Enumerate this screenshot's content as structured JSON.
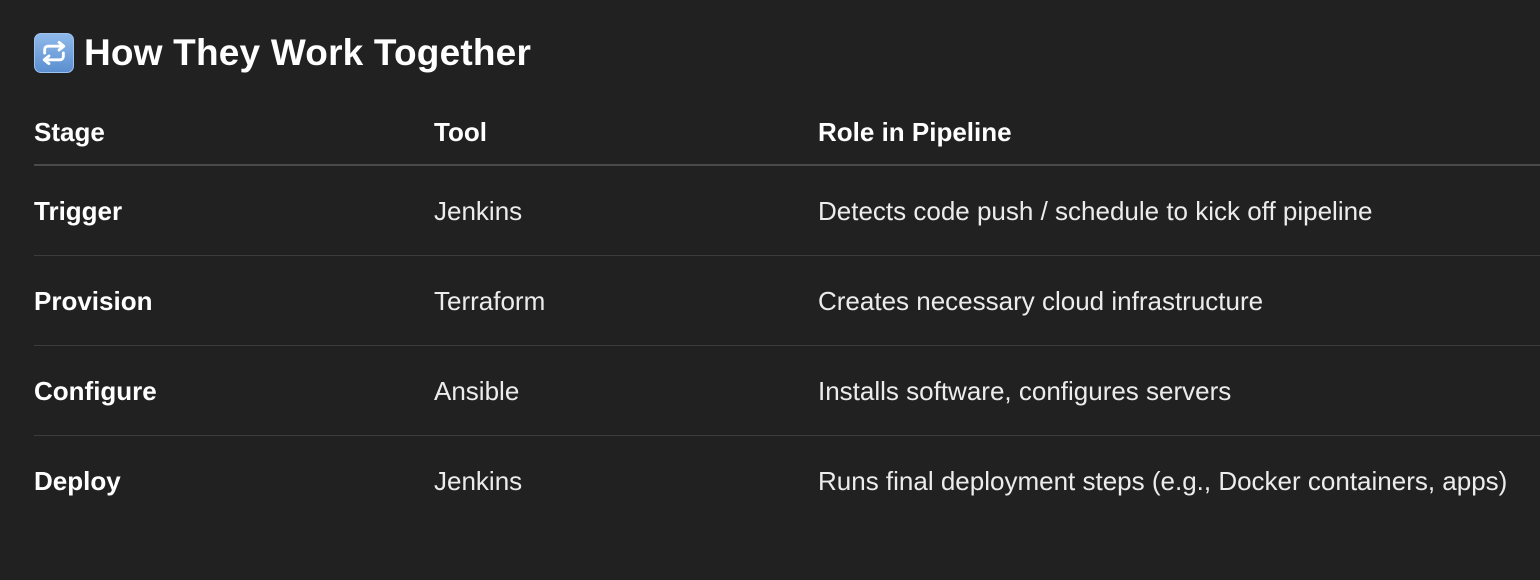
{
  "heading": {
    "icon": "repeat-arrows-icon",
    "title": "How They Work Together"
  },
  "table": {
    "headers": [
      "Stage",
      "Tool",
      "Role in Pipeline"
    ],
    "rows": [
      {
        "stage": "Trigger",
        "tool": "Jenkins",
        "role": "Detects code push / schedule to kick off pipeline"
      },
      {
        "stage": "Provision",
        "tool": "Terraform",
        "role": "Creates necessary cloud infrastructure"
      },
      {
        "stage": "Configure",
        "tool": "Ansible",
        "role": "Installs software, configures servers"
      },
      {
        "stage": "Deploy",
        "tool": "Jenkins",
        "role": "Runs final deployment steps (e.g., Docker containers, apps)"
      }
    ]
  },
  "colors": {
    "background": "#212121",
    "icon_blue": "#6b9be0"
  }
}
